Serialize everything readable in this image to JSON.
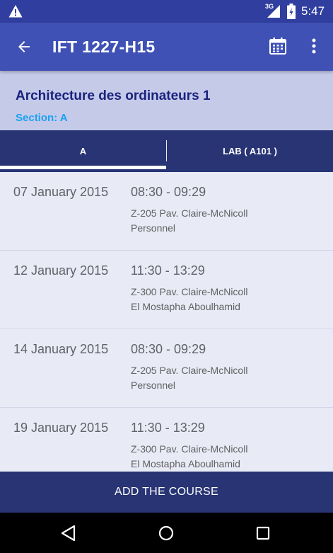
{
  "status_bar": {
    "network_label": "3G",
    "time": "5:47",
    "icons": [
      "warning-icon",
      "signal-icon",
      "battery-icon"
    ]
  },
  "app_bar": {
    "title": "IFT 1227-H15",
    "icons": [
      "back-arrow-icon",
      "calendar-icon",
      "more-vert-icon"
    ]
  },
  "course": {
    "title": "Architecture des ordinateurs 1",
    "section": "Section: A"
  },
  "tabs": [
    {
      "label": "A",
      "selected": true
    },
    {
      "label": "LAB ( A101 )",
      "selected": false
    }
  ],
  "sessions": [
    {
      "date": "07 January 2015",
      "time": "08:30 - 09:29",
      "room": "Z-205 Pav. Claire-McNicoll",
      "teacher": "Personnel"
    },
    {
      "date": "12 January 2015",
      "time": "11:30 - 13:29",
      "room": "Z-300 Pav. Claire-McNicoll",
      "teacher": "El Mostapha Aboulhamid"
    },
    {
      "date": "14 January 2015",
      "time": "08:30 - 09:29",
      "room": "Z-205 Pav. Claire-McNicoll",
      "teacher": "Personnel"
    },
    {
      "date": "19 January 2015",
      "time": "11:30 - 13:29",
      "room": "Z-300 Pav. Claire-McNicoll",
      "teacher": "El Mostapha Aboulhamid"
    }
  ],
  "add_button": {
    "label": "ADD THE COURSE"
  },
  "nav_bar": {
    "icons": [
      "nav-back-icon",
      "nav-home-icon",
      "nav-recents-icon"
    ]
  },
  "colors": {
    "status_bar": "#303f9f",
    "app_bar": "#3f51b5",
    "course_header": "#c5cae9",
    "tabs": "#283474",
    "section_accent": "#1da1f2",
    "list_background": "#e8eaf6"
  }
}
